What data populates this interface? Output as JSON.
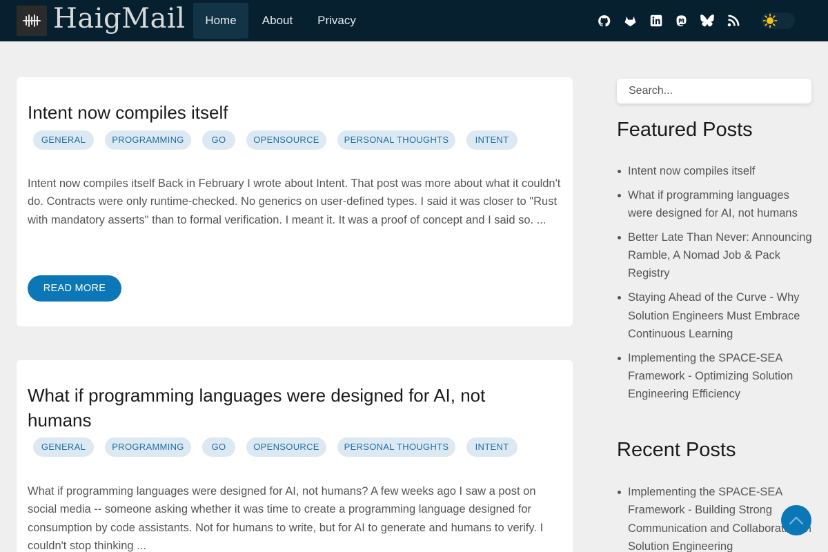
{
  "header": {
    "brand": "HaigMail",
    "nav": [
      "Home",
      "About",
      "Privacy"
    ],
    "social_icons": [
      "github-icon",
      "gitlab-icon",
      "linkedin-icon",
      "mastodon-icon",
      "bluesky-icon",
      "rss-icon"
    ],
    "theme_toggle_icon": "sun-icon",
    "colors": {
      "bar": "#06202f",
      "active_nav": "#123446"
    }
  },
  "posts": [
    {
      "title": "Intent now compiles itself",
      "tags": [
        "GENERAL",
        "PROGRAMMING",
        "GO",
        "OPENSOURCE",
        "PERSONAL THOUGHTS",
        "INTENT"
      ],
      "excerpt": "Intent now compiles itself Back in February I wrote about Intent. That post was more about what it couldn't do. Contracts were only runtime-checked. No generics on user-defined types. I said it was closer to \"Rust with mandatory asserts\" than to formal verification. I meant it. It was a proof of concept and I said so. ...",
      "read_more": "READ MORE"
    },
    {
      "title": "What if programming languages were designed for AI, not humans",
      "tags": [
        "GENERAL",
        "PROGRAMMING",
        "GO",
        "OPENSOURCE",
        "PERSONAL THOUGHTS",
        "INTENT"
      ],
      "excerpt": "What if programming languages were designed for AI, not humans? A few weeks ago I saw a post on social media -- someone asking whether it was time to create a programming language designed for consumption by code assistants. Not for humans to write, but for AI to generate and humans to verify. I couldn't stop thinking ..."
    }
  ],
  "sidebar": {
    "search_placeholder": "Search...",
    "featured_heading": "Featured Posts",
    "featured": [
      "Intent now compiles itself",
      "What if programming languages were designed for AI, not humans",
      "Better Late Than Never: Announcing Ramble, A Nomad Job & Pack Registry",
      "Staying Ahead of the Curve - Why Solution Engineers Must Embrace Continuous Learning",
      "Implementing the SPACE-SEA Framework - Optimizing Solution Engineering Efficiency"
    ],
    "recent_heading": "Recent Posts",
    "recent": [
      "Implementing the SPACE-SEA Framework - Building Strong Communication and Collaboration in Solution Engineering"
    ]
  },
  "scroll_top_icon": "chevron-up-icon",
  "accent_color": "#0b77b6"
}
